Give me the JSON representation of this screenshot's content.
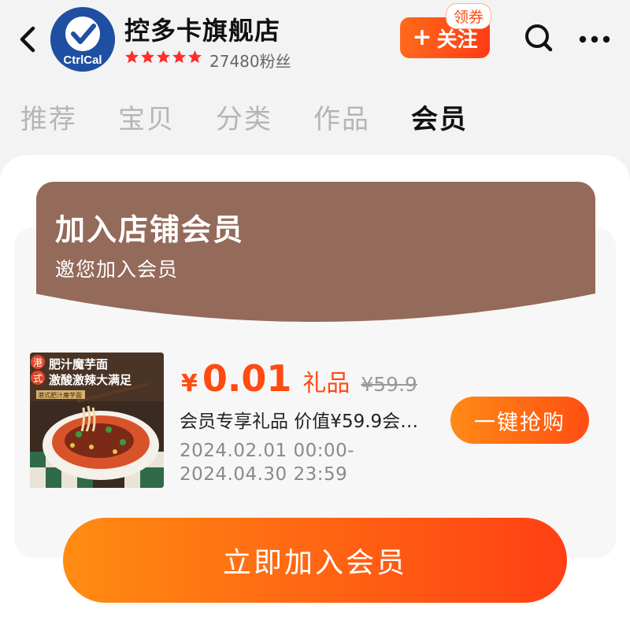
{
  "header": {
    "shop_name": "控多卡旗舰店",
    "logo_text": "CtrlCal",
    "rating_stars": 5,
    "fans": "27480粉丝",
    "follow_label": "关注",
    "coupon_label": "领券"
  },
  "tabs": [
    "推荐",
    "宝贝",
    "分类",
    "作品",
    "会员"
  ],
  "active_tab": "会员",
  "banner": {
    "title": "加入店铺会员",
    "subtitle": "邀您加入会员"
  },
  "product": {
    "image_text_1": "肥汁魔芋面",
    "image_text_2": "激酸激辣大满足",
    "image_badge_1": "港",
    "image_badge_2": "式",
    "image_note": "港式肥汁魔芋面",
    "price_symbol": "¥",
    "price": "0.01",
    "gift_label": "礼品",
    "original_price": "¥59.9",
    "description": "会员专享礼品 价值¥59.9会…",
    "date_start": "2024.02.01 00:00-",
    "date_end": "2024.04.30 23:59",
    "buy_label": "一键抢购"
  },
  "join_label": "立即加入会员",
  "colors": {
    "accent": "#ff4a12",
    "banner": "#946a5a",
    "logo_bg": "#1f4fa2"
  }
}
